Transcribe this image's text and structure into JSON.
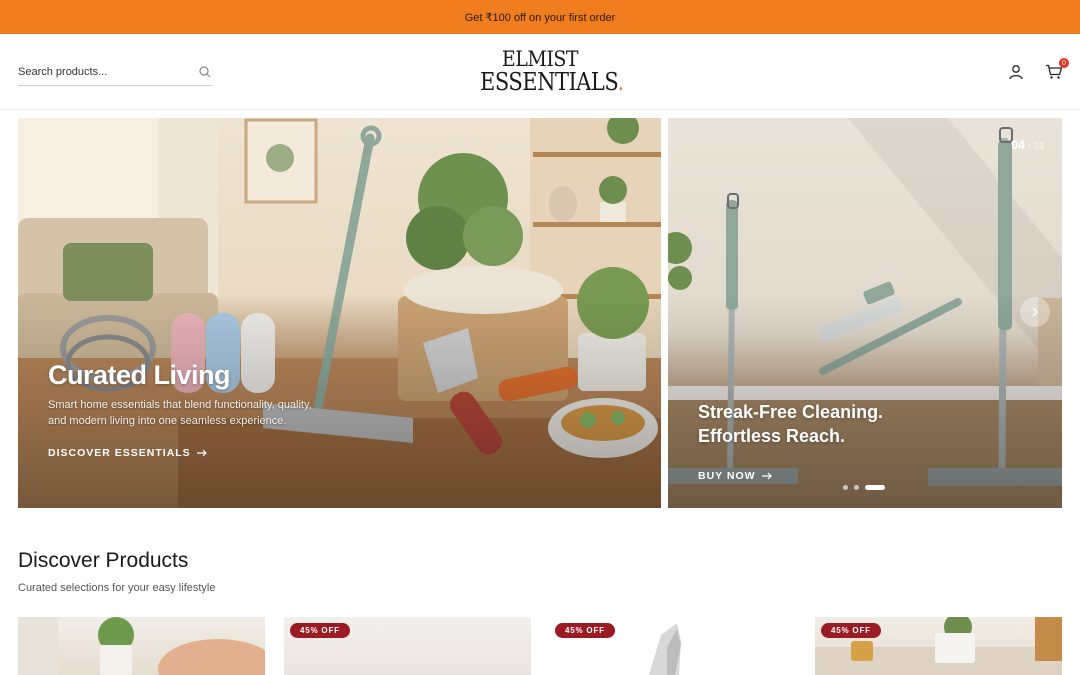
{
  "announcement": "Get ₹100 off on your first order",
  "search": {
    "placeholder": "Search products..."
  },
  "brand": {
    "line1": "ELMIST",
    "line2": "ESSENTIALS",
    "accent": "."
  },
  "header_icons": [
    "user-icon",
    "cart-icon"
  ],
  "cart": {
    "count": "0"
  },
  "hero_slides": [
    {
      "title": "Curated Living",
      "description": "Smart home essentials that blend functionality, quality, and modern living into one seamless experience.",
      "cta": "DISCOVER ESSENTIALS"
    },
    {
      "title_line1": "Streak-Free Cleaning.",
      "title_line2": "Effortless Reach.",
      "cta": "BUY NOW"
    }
  ],
  "slider": {
    "current": "04",
    "separator": "/",
    "total": "03",
    "dot_count": 3,
    "active_dot": 3
  },
  "section": {
    "title": "Discover Products",
    "subtitle": "Curated selections for your easy lifestyle"
  },
  "product_badges": [
    "",
    "45% OFF",
    "45% OFF",
    "45% OFF"
  ],
  "colors": {
    "accent": "#f07e1f",
    "badge": "#9b1b24",
    "cart_badge": "#d9381e"
  }
}
